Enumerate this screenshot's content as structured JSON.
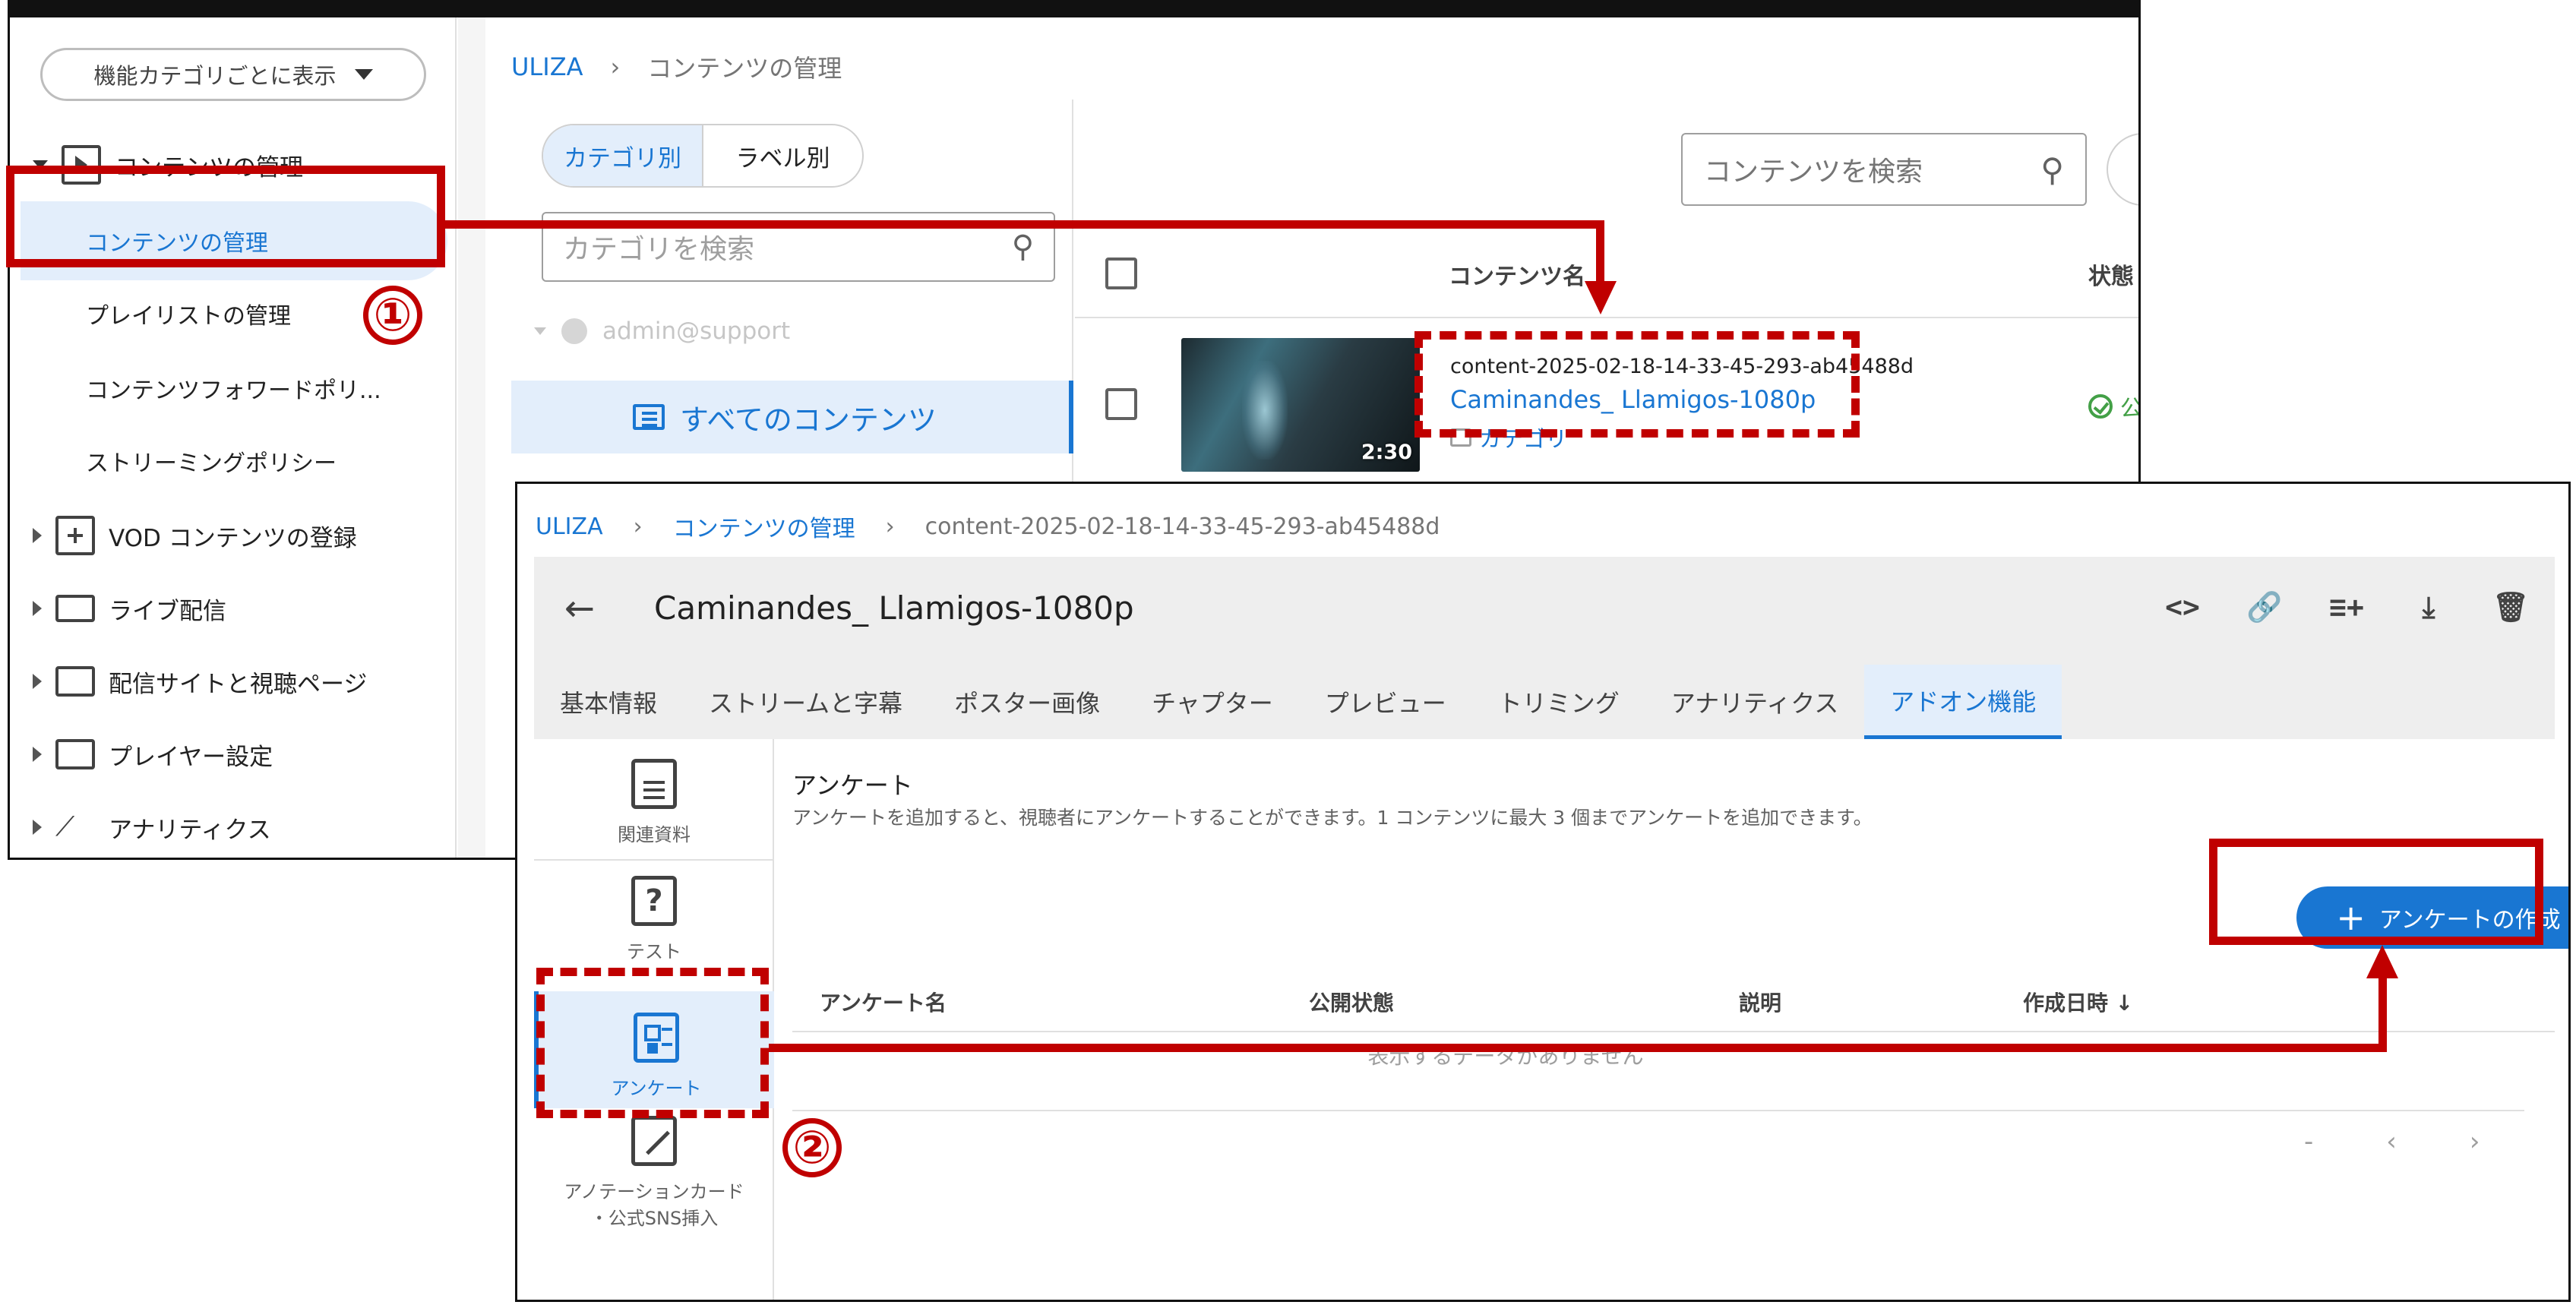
{
  "screen1": {
    "view_selector": "機能カテゴリごとに表示",
    "sidebar": {
      "group_content": "コンテンツの管理",
      "items": [
        {
          "label": "コンテンツの管理"
        },
        {
          "label": "プレイリストの管理"
        },
        {
          "label": "コンテンツフォワードポリ..."
        },
        {
          "label": "ストリーミングポリシー"
        }
      ],
      "groups": [
        {
          "label": "VOD コンテンツの登録"
        },
        {
          "label": "ライブ配信"
        },
        {
          "label": "配信サイトと視聴ページ"
        },
        {
          "label": "プレイヤー設定"
        },
        {
          "label": "アナリティクス"
        }
      ]
    },
    "breadcrumb": {
      "root": "ULIZA",
      "sep": "›",
      "current": "コンテンツの管理"
    },
    "category_toggle": {
      "by_category": "カテゴリ別",
      "by_label": "ラベル別"
    },
    "category_search_placeholder": "カテゴリを検索",
    "tree_user": "admin@support",
    "all_contents": "すべてのコンテンツ",
    "content_search_placeholder": "コンテンツを検索",
    "table_headers": {
      "name": "コンテンツ名",
      "state": "状態"
    },
    "row": {
      "content_id": "content-2025-02-18-14-33-45-293-ab45488d",
      "title": "Caminandes_ Llamigos-1080p",
      "category": "カテゴリ",
      "duration": "2:30",
      "state": "公"
    }
  },
  "screen2": {
    "breadcrumb": {
      "root": "ULIZA",
      "section": "コンテンツの管理",
      "current": "content-2025-02-18-14-33-45-293-ab45488d",
      "sep": "›"
    },
    "title": "Caminandes_ Llamigos-1080p",
    "back_glyph": "←",
    "actions": [
      "<>",
      "🔗",
      "≡+",
      "⤓",
      "🗑"
    ],
    "tabs": [
      {
        "label": "基本情報"
      },
      {
        "label": "ストリームと字幕"
      },
      {
        "label": "ポスター画像"
      },
      {
        "label": "チャプター"
      },
      {
        "label": "プレビュー"
      },
      {
        "label": "トリミング"
      },
      {
        "label": "アナリティクス"
      },
      {
        "label": "アドオン機能"
      }
    ],
    "addons": [
      {
        "label": "関連資料"
      },
      {
        "label": "テスト"
      },
      {
        "label": "アンケート"
      },
      {
        "label": "アノテーションカード",
        "label2": "・公式SNS挿入"
      }
    ],
    "section_title": "アンケート",
    "section_desc": "アンケートを追加すると、視聴者にアンケートすることができます。1 コンテンツに最大 3 個までアンケートを追加できます。",
    "create_button": "アンケートの作成",
    "table_headers": {
      "name": "アンケート名",
      "status": "公開状態",
      "desc": "説明",
      "created": "作成日時 ↓"
    },
    "empty_message": "表示するデータがありません",
    "pager": {
      "range": "-",
      "prev": "‹",
      "next": "›"
    }
  },
  "annotations": {
    "step1": "①",
    "step2": "②",
    "color": "#c00000"
  }
}
